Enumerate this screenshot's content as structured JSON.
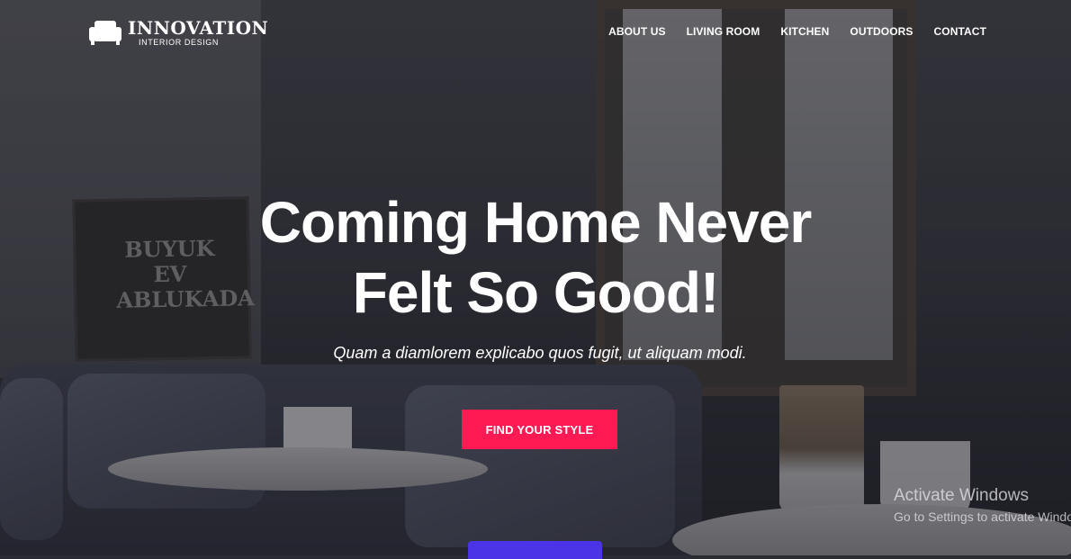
{
  "brand": {
    "title": "INNOVATION",
    "subtitle": "INTERIOR DESIGN"
  },
  "nav": [
    {
      "label": "ABOUT US"
    },
    {
      "label": "LIVING ROOM"
    },
    {
      "label": "KITCHEN"
    },
    {
      "label": "OUTDOORS"
    },
    {
      "label": "CONTACT"
    }
  ],
  "hero": {
    "headline_line1": "Coming Home Never",
    "headline_line2": "Felt So Good!",
    "tagline": "Quam a diamlorem explicabo quos fugit, ut aliquam modi.",
    "cta_label": "FIND YOUR STYLE",
    "poster_text": "BUYUK EV ABLUKADA"
  },
  "watermark": {
    "title": "Activate Windows",
    "subtitle": "Go to Settings to activate Windows."
  },
  "colors": {
    "accent": "#ff1a54",
    "secondary": "#4b33e6"
  },
  "icons": {
    "logo": "sofa-icon"
  }
}
